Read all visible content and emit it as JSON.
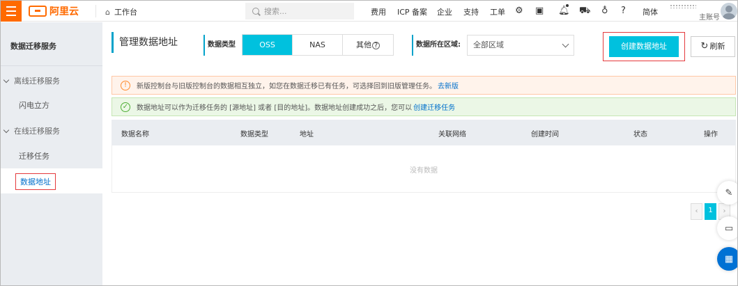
{
  "topbar": {
    "logo_text": "阿里云",
    "workbench": "工作台",
    "search_placeholder": "搜索...",
    "nav": [
      "费用",
      "ICP 备案",
      "企业",
      "支持",
      "工单"
    ],
    "lang": "简体",
    "account": "主账号"
  },
  "sidebar": {
    "title": "数据迁移服务",
    "groups": [
      {
        "label": "离线迁移服务",
        "items": [
          "闪电立方"
        ]
      },
      {
        "label": "在线迁移服务",
        "items": [
          "迁移任务",
          "数据地址"
        ]
      }
    ],
    "active": "数据地址"
  },
  "header": {
    "title": "管理数据地址",
    "type_label": "数据类型",
    "types": [
      "OSS",
      "NAS",
      "其他"
    ],
    "selected_type": "OSS",
    "region_label": "数据所在区域:",
    "region_value": "全部区域",
    "create_button": "创建数据地址",
    "refresh_button": "刷新"
  },
  "alerts": {
    "warning_text": "新版控制台与旧版控制台的数据相互独立，如您在数据迁移已有任务，可选择回到旧版管理任务。",
    "warning_link": "去新版",
    "info_text": "数据地址可以作为迁移任务的 [源地址] 或者 [目的地址]。数据地址创建成功之后，您可以",
    "info_link": "创建迁移任务"
  },
  "table": {
    "columns": [
      "数据名称",
      "数据类型",
      "地址",
      "关联网络",
      "创建时间",
      "状态",
      "操作"
    ],
    "empty_text": "没有数据"
  },
  "pagination": {
    "current": "1"
  },
  "colors": {
    "brand": "#ff6a00",
    "accent": "#00c1de",
    "highlight_outline": "#e4393c",
    "link": "#0070cc"
  }
}
